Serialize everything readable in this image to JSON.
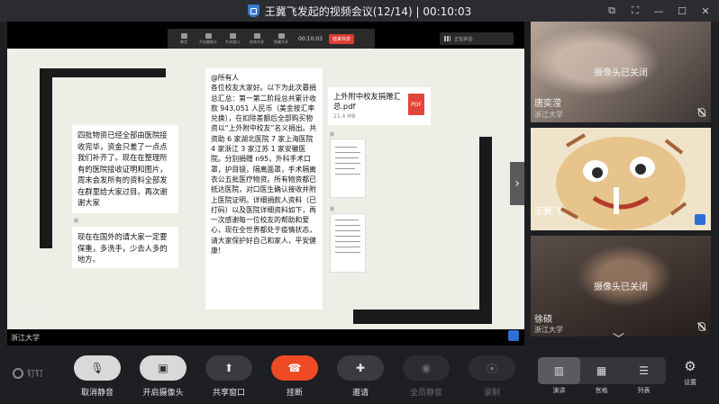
{
  "window": {
    "title": "王冀飞发起的视频会议(12/14) | 00:10:03",
    "controls": [
      "restore-down",
      "fullscreen",
      "minimize",
      "maximize",
      "close"
    ]
  },
  "share_toolbar": {
    "items": [
      "静音",
      "开启摄像头",
      "共享窗口",
      "结束共享",
      "隐藏共享"
    ],
    "timer": "00:10:03",
    "end_label": "结束共享",
    "speaker_label": "正在讲话:"
  },
  "document": {
    "left_message": "四批物资已经全部由医院接收完毕，资金只差了一点点我们补齐了。现在在整理所有的医院接收证明和图片，周末会发所有的资料全部发在群里给大家过目。再次谢谢大家",
    "left_meta": "我",
    "left_message_2": "现在在国外的请大家一定要保重，多洗手，少去人多的地方。",
    "center_message": "@所有人\n各位校友大家好。以下为此次募捐总汇总：第一第二阶段总共累计收款 943,051 人民币（美金按汇率兑换），在扣除差额后全部购买物资以“上外附中校友”名义捐出。共资助 6 家湖北医院 7 家上海医院 4 家浙江 3 家江苏 1 家安徽医院。分别捐赠 n95，外科手术口罩，护目镜，隔离面罩，手术隔离衣公五批医疗物资。所有物资都已抵达医院，对口医生确认接收并附上医院证明。详细捐款人资料（已打码）以及医院详细资料如下，再一次感谢每一位校友的帮助和爱心，现在全世界都处于疫情状态，请大家保护好自己和家人，平安健康！",
    "pdf_name": "上外附中校友捐赠汇总.pdf",
    "pdf_size": "21.4 MB",
    "pdf_badge": "PDF",
    "thumb_meta_1": "我",
    "thumb_meta_2": "我"
  },
  "stage": {
    "presenter_name": "王冀飞",
    "presenter_org": "浙江大学"
  },
  "participants": [
    {
      "name": "唐奕滢",
      "org": "浙江大学",
      "camera": "摄像头已关闭",
      "mic_muted": true
    },
    {
      "name": "王冀飞",
      "org": "",
      "camera": "",
      "mic_muted": false,
      "active_speaker": true
    },
    {
      "name": "徐硕",
      "org": "浙江大学",
      "camera": "摄像头已关闭",
      "mic_muted": true
    }
  ],
  "toolbar": {
    "brand": "钉钉",
    "buttons": [
      {
        "label": "取消静音",
        "icon": "mic-off-icon"
      },
      {
        "label": "开启摄像头",
        "icon": "camera-off-icon"
      },
      {
        "label": "共享窗口",
        "icon": "share-screen-icon"
      },
      {
        "label": "挂断",
        "icon": "hangup-icon"
      },
      {
        "label": "邀请",
        "icon": "invite-icon"
      },
      {
        "label": "全员静音",
        "icon": "mute-all-icon"
      },
      {
        "label": "录制",
        "icon": "record-icon"
      }
    ],
    "views": [
      "演讲",
      "宫格",
      "列表"
    ],
    "settings_label": "设置"
  },
  "colors": {
    "hangup": "#f04a24",
    "active_speaker_border": "#22c06a",
    "pdf_red": "#e2463a",
    "brand_blue": "#3a7bd5"
  }
}
